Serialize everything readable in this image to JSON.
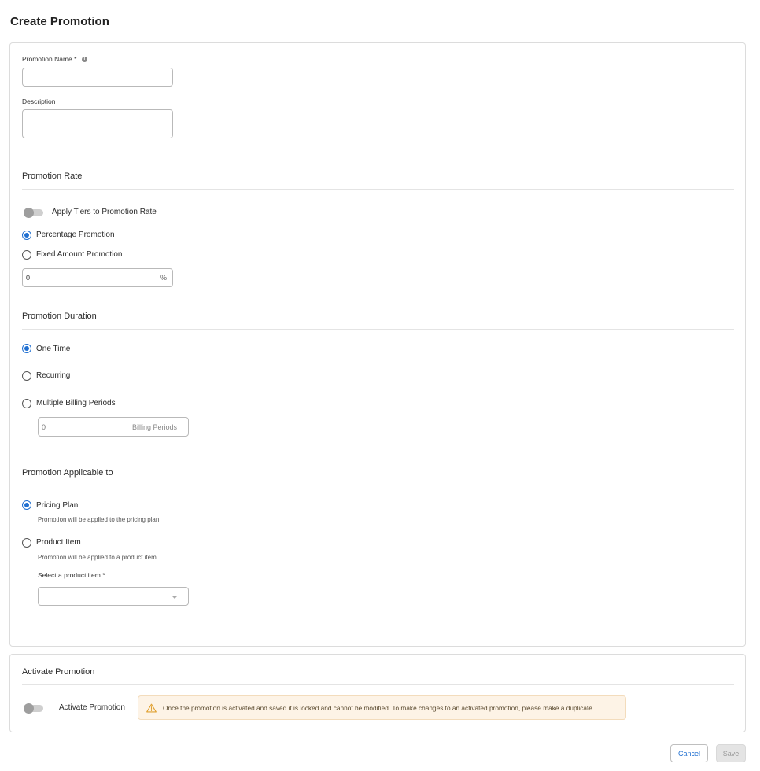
{
  "page": {
    "title": "Create Promotion"
  },
  "basic": {
    "name_label": "Promotion Name",
    "required_mark": "*",
    "name_value": "",
    "description_label": "Description",
    "description_value": ""
  },
  "rate": {
    "section_title": "Promotion Rate",
    "tiers_toggle_label": "Apply Tiers to Promotion Rate",
    "tiers_toggle_on": false,
    "options": [
      {
        "label": "Percentage Promotion",
        "checked": true
      },
      {
        "label": "Fixed Amount Promotion",
        "checked": false
      }
    ],
    "value": "0",
    "suffix": "%"
  },
  "duration": {
    "section_title": "Promotion Duration",
    "options": [
      {
        "label": "One Time",
        "checked": true
      },
      {
        "label": "Recurring",
        "checked": false
      },
      {
        "label": "Multiple Billing Periods",
        "checked": false
      }
    ],
    "periods_placeholder": "0",
    "periods_suffix": "Billing Periods"
  },
  "applicable": {
    "section_title": "Promotion Applicable to",
    "options": [
      {
        "label": "Pricing Plan",
        "hint": "Promotion will be applied to the pricing plan.",
        "checked": true
      },
      {
        "label": "Product Item",
        "hint": "Promotion will be applied to a product item.",
        "checked": false
      }
    ],
    "select_label": "Select a product item",
    "select_value": ""
  },
  "activate": {
    "section_title": "Activate Promotion",
    "toggle_label": "Activate Promotion",
    "toggle_on": false,
    "warning": "Once the promotion is activated and saved it is locked and cannot be modified. To make changes to an activated promotion, please make a duplicate."
  },
  "actions": {
    "cancel_label": "Cancel",
    "save_label": "Save"
  },
  "colors": {
    "accent": "#1f6fd1",
    "warning_bg": "#fdf3e6",
    "warning_icon": "#e0a030"
  },
  "icons": {
    "info": "info-icon",
    "warning": "warning-triangle-icon",
    "dropdown": "chevron-down-icon"
  }
}
